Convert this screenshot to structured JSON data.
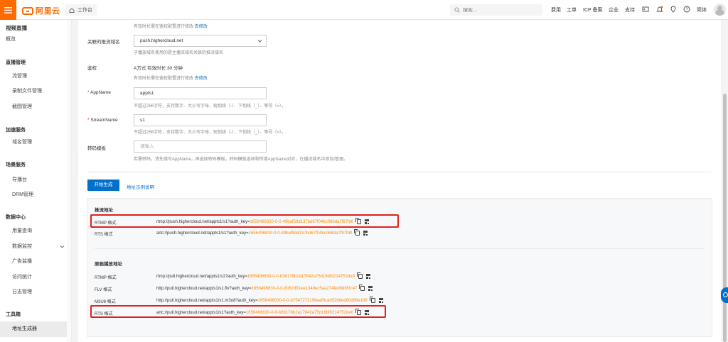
{
  "topbar": {
    "brand": "阿里云",
    "workbench": "工作台",
    "search_placeholder": "搜索...",
    "nav": [
      "费用",
      "工单",
      "ICP 备案",
      "企业",
      "支持"
    ],
    "lang": "简体"
  },
  "sidebar": {
    "title": "视频直播",
    "overview": "概览",
    "sections": [
      {
        "title": "直播管理",
        "items": [
          "流管理",
          "录制文件管理",
          "截图管理"
        ]
      },
      {
        "title": "加速服务",
        "items": [
          "域名管理"
        ]
      },
      {
        "title": "场景服务",
        "items": [
          "导播台",
          "DRM管理"
        ]
      },
      {
        "title": "数据中心",
        "items": [
          "用量查询",
          "数据监控",
          "广告监播",
          "访问统计",
          "日志管理"
        ]
      },
      {
        "title": "工具箱",
        "items": [
          "地址生成器"
        ]
      }
    ]
  },
  "form": {
    "top_hint": "有效时长需在鉴权配置进行修改",
    "top_hint_link": "去修改",
    "push_domain_label": "关联的推流域名",
    "push_domain_value": "push.highercloud.net",
    "push_domain_hint": "子播放域名使用的是主播流域名关联的推流域名",
    "auth_label": "鉴权",
    "auth_value": "A方式 有效时长 30 分钟",
    "auth_hint": "有效时长需在鉴权配置进行修改",
    "auth_hint_link": "去修改",
    "appname_label": "AppName",
    "appname_value": "appts1",
    "appname_hint": "不超过256字符，支持数字、大小写字母、短划线（-）、下划线（_）、等号（=）。",
    "stream_label": "StreamName",
    "stream_value": "s1",
    "stream_hint": "不超过256字符，支持数字、大小写字母、短划线（-）、下划线（_）、等号（=）。",
    "transcode_label": "转码模板",
    "transcode_placeholder": "请输入",
    "transcode_hint": "若需转码，请先填写AppName，再选择转码模板。转码模板选项和所填AppName对应，在播流域名中添加/管理。",
    "generate_button": "开始生成",
    "example_link": "地址示例说明"
  },
  "result": {
    "push_title": "推流地址",
    "push_rows": [
      {
        "label": "RTMP 格式",
        "base": "rtmp://push.highercloud.net/appts1/s1?auth_key=",
        "key": "1656496830-0-0-49baf59d137bd67f04bc068da7f97fd0"
      },
      {
        "label": "RTS 格式",
        "base": "artc://push.highercloud.net/appts1/s1?auth_key=",
        "key": "1656496830-0-0-49baf59d137bd67f04bc068da7f97fd0"
      }
    ],
    "play_title": "原画播放地址",
    "play_rows": [
      {
        "label": "RTMP 格式",
        "base": "rtmp://pull.highercloud.net/appts1/s1?auth_key=",
        "key": "1656496830-0-0-b38178b2a17842a75d16bf0214752de0"
      },
      {
        "label": "FLV 格式",
        "base": "http://pull.highercloud.net/appts1/s1.flv?auth_key=",
        "key": "1656496830-0-0-8082d91ee1349ec5aa274fed9d6f3c47"
      },
      {
        "label": "M3U8 格式",
        "base": "http://pull.highercloud.net/appts1/s1.m3u8?auth_key=",
        "key": "1656496830-0-0-b7547273199eaf6cab52b6ed60d88e188"
      },
      {
        "label": "RTS 格式",
        "base": "artc://pull.highercloud.net/appts1/s1?auth_key=",
        "key": "1656496830-0-0-b38178b2a17842a75d16bf0214752de0"
      }
    ]
  },
  "colors": {
    "accent": "#ff6a00",
    "link": "#0070cc",
    "key": "#ff8a00",
    "highlight": "#e02020"
  }
}
